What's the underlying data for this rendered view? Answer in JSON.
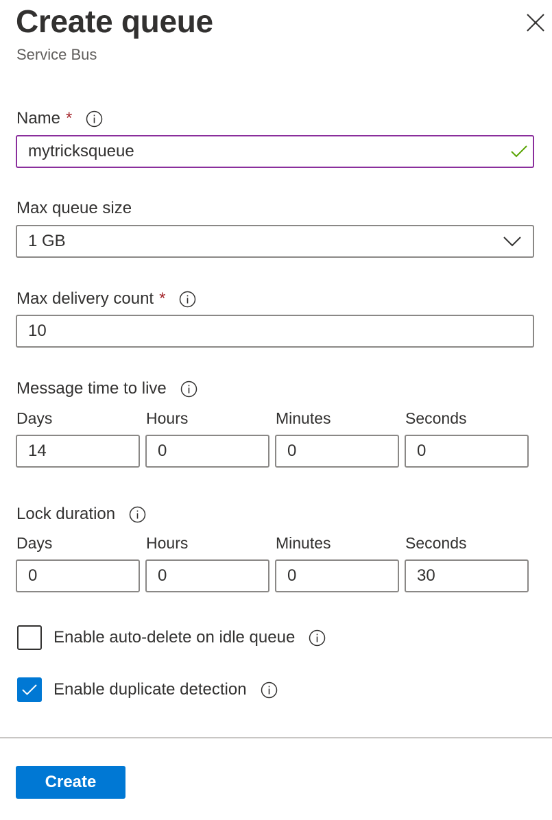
{
  "header": {
    "title": "Create queue",
    "subtitle": "Service Bus",
    "close_icon": "close-icon"
  },
  "name_field": {
    "label": "Name",
    "required_mark": "*",
    "value": "mytricksqueue",
    "valid_icon": "checkmark-icon",
    "valid_color": "#57a300"
  },
  "max_queue_size": {
    "label": "Max queue size",
    "selected": "1 GB",
    "dropdown_icon": "chevron-down-icon"
  },
  "max_delivery_count": {
    "label": "Max delivery count",
    "required_mark": "*",
    "value": "10"
  },
  "message_ttl": {
    "label": "Message time to live",
    "units": [
      {
        "label": "Days",
        "value": "14"
      },
      {
        "label": "Hours",
        "value": "0"
      },
      {
        "label": "Minutes",
        "value": "0"
      },
      {
        "label": "Seconds",
        "value": "0"
      }
    ]
  },
  "lock_duration": {
    "label": "Lock duration",
    "units": [
      {
        "label": "Days",
        "value": "0"
      },
      {
        "label": "Hours",
        "value": "0"
      },
      {
        "label": "Minutes",
        "value": "0"
      },
      {
        "label": "Seconds",
        "value": "30"
      }
    ]
  },
  "options": {
    "auto_delete": {
      "label": "Enable auto-delete on idle queue",
      "checked": false
    },
    "duplicate_detection": {
      "label": "Enable duplicate detection",
      "checked": true
    }
  },
  "footer": {
    "create_label": "Create"
  },
  "colors": {
    "accent": "#0078d4",
    "required": "#a4262c",
    "focus_border": "#8a2e9c",
    "text": "#323130",
    "subtext": "#605e5c"
  }
}
